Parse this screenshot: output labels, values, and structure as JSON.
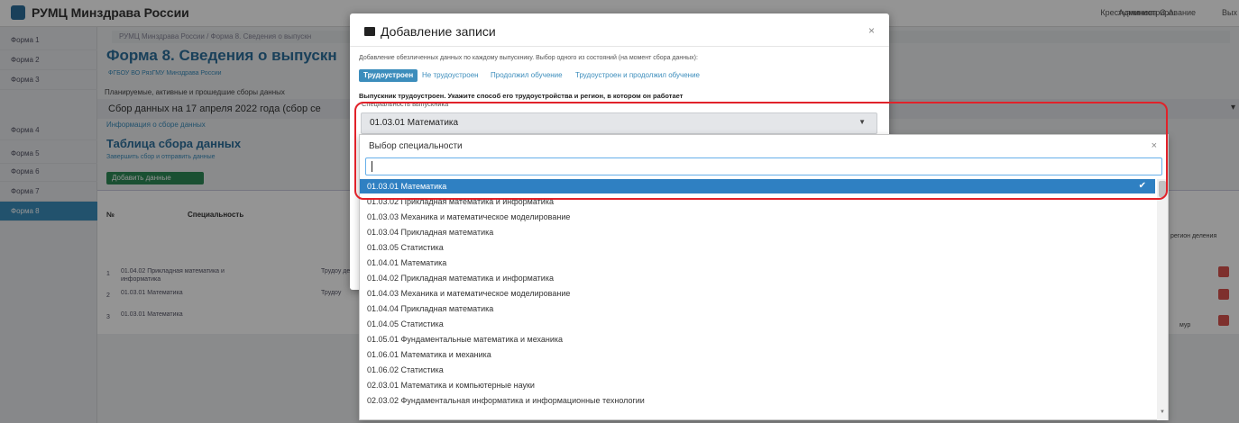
{
  "app": {
    "brand": "РУМЦ Минздрава России",
    "user": "Крестьянинова О.А.",
    "admin": "Администрирование",
    "exit": "Вых"
  },
  "sidebar": {
    "items": [
      {
        "label": "Форма 1"
      },
      {
        "label": "Форма 2"
      },
      {
        "label": "Форма 3"
      },
      {
        "label": "Форма 4"
      },
      {
        "label": "Форма 5"
      },
      {
        "label": "Форма 6"
      },
      {
        "label": "Форма 7"
      },
      {
        "label": "Форма 8"
      }
    ]
  },
  "main": {
    "breadcrumb": "РУМЦ Минздрава России / Форма 8. Сведения о выпускн",
    "title": "Форма 8. Сведения о выпускн",
    "org": "ФГБОУ ВО РязГМУ Минздрава России",
    "planned": "Планируемые, активные и прошедшие сборы данных",
    "collect_bar": "Сбор данных на 17 апреля 2022 года (сбор се",
    "info_link": "Информация о сборе данных",
    "table_title": "Таблица сбора данных",
    "finish_link": "Завершить сбор и отправить данные",
    "add_data": "Добавить данные",
    "table": {
      "headers": {
        "num": "№",
        "spec": "Специальность"
      },
      "rows": [
        {
          "n": "1",
          "spec": "01.04.02 Прикладная математика и информатика",
          "extra": "Трудоу деяте"
        },
        {
          "n": "2",
          "spec": "01.03.01 Математика",
          "extra": "Трудоу"
        },
        {
          "n": "3",
          "spec": "01.03.01 Математика",
          "extra": ""
        }
      ],
      "right_col_a": "регион деления",
      "right_col_b": "мур"
    }
  },
  "modal": {
    "title": "Добавление записи",
    "close": "×",
    "description": "Добавление обезличенных данных по каждому выпускнику. Выбор одного из состояний (на момент сбора данных):",
    "tabs": [
      {
        "label": "Трудоустроен",
        "active": true
      },
      {
        "label": "Не трудоустроен",
        "active": false
      },
      {
        "label": "Продолжил обучение",
        "active": false
      },
      {
        "label": "Трудоустроен и продолжил обучение",
        "active": false
      }
    ],
    "hint": "Выпускник трудоустроен. Укажите способ его трудоустройства и регион, в котором он работает",
    "field_label": "Специальность выпускника",
    "selected_value": "01.03.01 Математика"
  },
  "dropdown": {
    "title": "Выбор специальности",
    "close": "×",
    "search_value": "",
    "options": [
      {
        "label": "01.03.01 Математика",
        "selected": true
      },
      {
        "label": "01.03.02 Прикладная математика и информатика",
        "selected": false
      },
      {
        "label": "01.03.03 Механика и математическое моделирование",
        "selected": false
      },
      {
        "label": "01.03.04 Прикладная математика",
        "selected": false
      },
      {
        "label": "01.03.05 Статистика",
        "selected": false
      },
      {
        "label": "01.04.01 Математика",
        "selected": false
      },
      {
        "label": "01.04.02 Прикладная математика и информатика",
        "selected": false
      },
      {
        "label": "01.04.03 Механика и математическое моделирование",
        "selected": false
      },
      {
        "label": "01.04.04 Прикладная математика",
        "selected": false
      },
      {
        "label": "01.04.05 Статистика",
        "selected": false
      },
      {
        "label": "01.05.01 Фундаментальные математика и механика",
        "selected": false
      },
      {
        "label": "01.06.01 Математика и механика",
        "selected": false
      },
      {
        "label": "01.06.02 Статистика",
        "selected": false
      },
      {
        "label": "02.03.01 Математика и компьютерные науки",
        "selected": false
      },
      {
        "label": "02.03.02 Фундаментальная информатика и информационные технологии",
        "selected": false
      }
    ],
    "check_glyph": "✔"
  },
  "colors": {
    "primary": "#3c8dbc",
    "selected": "#2f80c2",
    "annotation": "#e1222a",
    "success": "#2e8b57",
    "danger": "#d9534f"
  }
}
